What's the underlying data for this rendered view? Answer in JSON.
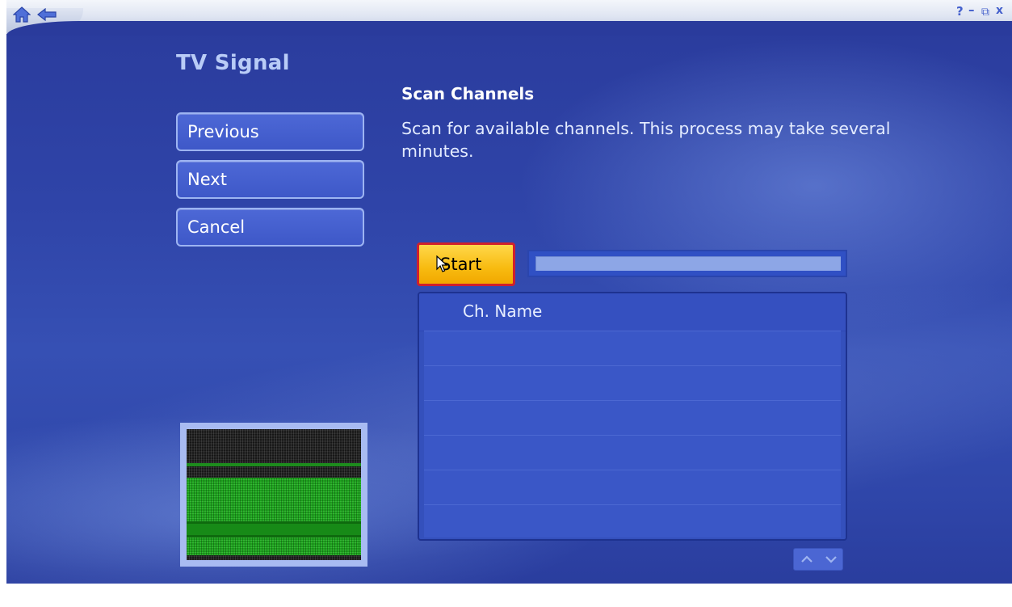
{
  "window": {
    "title_controls": {
      "help_glyph": "?",
      "minimize_glyph": "–",
      "restore_glyph": "⧉",
      "close_glyph": "x"
    },
    "nav": {
      "home_icon": "home-icon",
      "back_icon": "back-arrow-icon"
    }
  },
  "page": {
    "title": "TV Signal"
  },
  "sidebar": {
    "buttons": [
      {
        "label": "Previous"
      },
      {
        "label": "Next"
      },
      {
        "label": "Cancel"
      }
    ]
  },
  "main": {
    "heading": "Scan Channels",
    "description": "Scan for available channels. This process may take several minutes.",
    "start_label": "Start",
    "progress_fraction": 0,
    "table": {
      "column_header": "Ch. Name",
      "rows": [
        "",
        "",
        "",
        "",
        "",
        ""
      ]
    },
    "scroll": {
      "up_icon": "scroll-up-icon",
      "down_icon": "scroll-down-icon"
    }
  },
  "colors": {
    "accent_yellow": "#f8bb10",
    "focus_border_red": "#d0202c",
    "background_blue": "#2f44a8",
    "title_text_blue": "#b9ccf7"
  }
}
